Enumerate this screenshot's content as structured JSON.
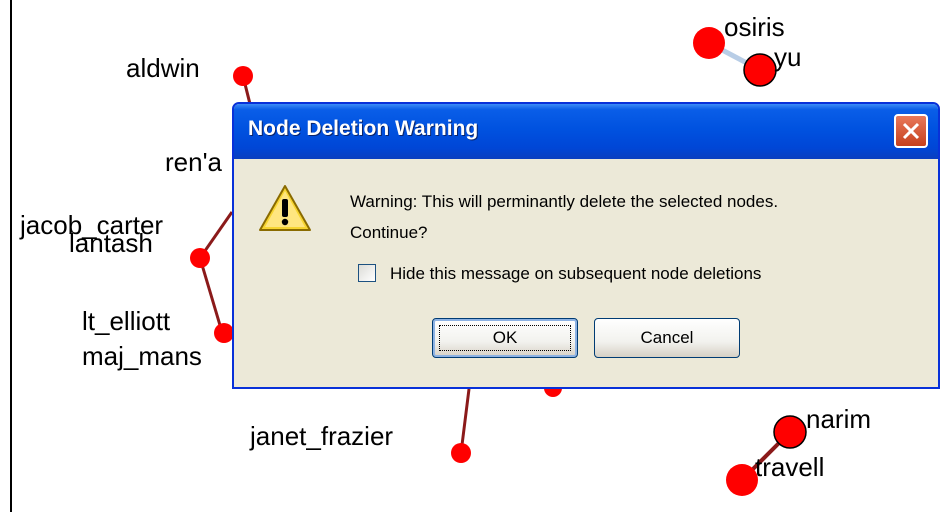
{
  "graph": {
    "nodes": [
      {
        "name": "osiris"
      },
      {
        "name": "yu"
      },
      {
        "name": "aldwin"
      },
      {
        "name": "ren'a"
      },
      {
        "name": "jacob_carter"
      },
      {
        "name": "lantash"
      },
      {
        "name": "lt_elliott"
      },
      {
        "name": "maj_mans"
      },
      {
        "name": "janet_frazier"
      },
      {
        "name": "narim"
      },
      {
        "name": "travell"
      }
    ],
    "node_color": "#ff0000",
    "edge_color": "#8b1a1a"
  },
  "dialog": {
    "title": "Node Deletion Warning",
    "message_line1": "Warning:  This will perminantly delete the selected nodes.",
    "message_line2": "Continue?",
    "checkbox_label": "Hide this message on subsequent node deletions",
    "checkbox_checked": false,
    "ok_label": "OK",
    "cancel_label": "Cancel",
    "icon": "warning-icon",
    "close_icon": "close-icon"
  }
}
